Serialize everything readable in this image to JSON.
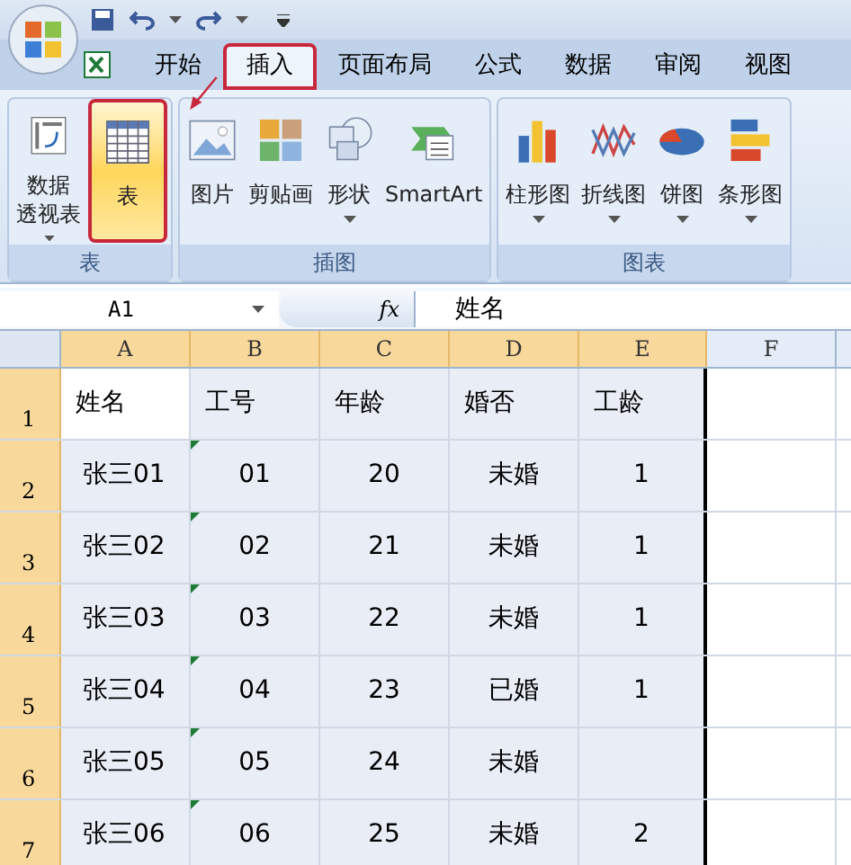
{
  "tabs": [
    {
      "label": "开始",
      "selected": false,
      "marked": false
    },
    {
      "label": "插入",
      "selected": true,
      "marked": true
    },
    {
      "label": "页面布局",
      "selected": false,
      "marked": false
    },
    {
      "label": "公式",
      "selected": false,
      "marked": false
    },
    {
      "label": "数据",
      "selected": false,
      "marked": false
    },
    {
      "label": "审阅",
      "selected": false,
      "marked": false
    },
    {
      "label": "视图",
      "selected": false,
      "marked": false
    }
  ],
  "ribbon": [
    {
      "title": "表",
      "buttons": [
        {
          "kind": "pivot",
          "label": "数据透视表",
          "dropdown": true,
          "highlighted": false
        },
        {
          "kind": "table",
          "label": "表",
          "dropdown": false,
          "highlighted": true
        }
      ]
    },
    {
      "title": "插图",
      "buttons": [
        {
          "kind": "picture",
          "label": "图片",
          "dropdown": false,
          "highlighted": false
        },
        {
          "kind": "clipart",
          "label": "剪贴画",
          "dropdown": false,
          "highlighted": false
        },
        {
          "kind": "shapes",
          "label": "形状",
          "dropdown": true,
          "highlighted": false
        },
        {
          "kind": "smartart",
          "label": "SmartArt",
          "dropdown": false,
          "highlighted": false
        }
      ]
    },
    {
      "title": "图表",
      "buttons": [
        {
          "kind": "column",
          "label": "柱形图",
          "dropdown": true,
          "highlighted": false
        },
        {
          "kind": "line",
          "label": "折线图",
          "dropdown": true,
          "highlighted": false
        },
        {
          "kind": "pie",
          "label": "饼图",
          "dropdown": true,
          "highlighted": false
        },
        {
          "kind": "bar",
          "label": "条形图",
          "dropdown": true,
          "highlighted": false
        }
      ]
    }
  ],
  "name_box": "A1",
  "fx": "fx",
  "formula": "姓名",
  "columns": [
    {
      "label": "A",
      "selected": true
    },
    {
      "label": "B",
      "selected": true
    },
    {
      "label": "C",
      "selected": true
    },
    {
      "label": "D",
      "selected": true
    },
    {
      "label": "E",
      "selected": true
    },
    {
      "label": "F",
      "selected": false
    }
  ],
  "rows": [
    {
      "header": "1",
      "selected": true,
      "cells": [
        {
          "text": "姓名",
          "active": true,
          "flag": false
        },
        {
          "text": "工号",
          "active": false,
          "flag": false
        },
        {
          "text": "年龄",
          "active": false,
          "flag": false
        },
        {
          "text": "婚否",
          "active": false,
          "flag": false
        },
        {
          "text": "工龄",
          "active": false,
          "flag": false
        }
      ]
    },
    {
      "header": "2",
      "selected": true,
      "cells": [
        {
          "text": "张三01",
          "active": false,
          "flag": false
        },
        {
          "text": "01",
          "active": false,
          "flag": true
        },
        {
          "text": "20",
          "active": false,
          "flag": false
        },
        {
          "text": "未婚",
          "active": false,
          "flag": false
        },
        {
          "text": "1",
          "active": false,
          "flag": false
        }
      ]
    },
    {
      "header": "3",
      "selected": true,
      "cells": [
        {
          "text": "张三02",
          "active": false,
          "flag": false
        },
        {
          "text": "02",
          "active": false,
          "flag": true
        },
        {
          "text": "21",
          "active": false,
          "flag": false
        },
        {
          "text": "未婚",
          "active": false,
          "flag": false
        },
        {
          "text": "1",
          "active": false,
          "flag": false
        }
      ]
    },
    {
      "header": "4",
      "selected": true,
      "cells": [
        {
          "text": "张三03",
          "active": false,
          "flag": false
        },
        {
          "text": "03",
          "active": false,
          "flag": true
        },
        {
          "text": "22",
          "active": false,
          "flag": false
        },
        {
          "text": "未婚",
          "active": false,
          "flag": false
        },
        {
          "text": "1",
          "active": false,
          "flag": false
        }
      ]
    },
    {
      "header": "5",
      "selected": true,
      "cells": [
        {
          "text": "张三04",
          "active": false,
          "flag": false
        },
        {
          "text": "04",
          "active": false,
          "flag": true
        },
        {
          "text": "23",
          "active": false,
          "flag": false
        },
        {
          "text": "已婚",
          "active": false,
          "flag": false
        },
        {
          "text": "1",
          "active": false,
          "flag": false
        }
      ]
    },
    {
      "header": "6",
      "selected": true,
      "cells": [
        {
          "text": "张三05",
          "active": false,
          "flag": false
        },
        {
          "text": "05",
          "active": false,
          "flag": true
        },
        {
          "text": "24",
          "active": false,
          "flag": false
        },
        {
          "text": "未婚",
          "active": false,
          "flag": false
        },
        {
          "active": false,
          "flag": false
        }
      ]
    },
    {
      "header": "7",
      "selected": true,
      "cells": [
        {
          "text": "张三06",
          "active": false,
          "flag": false
        },
        {
          "text": "06",
          "active": false,
          "flag": true
        },
        {
          "text": "25",
          "active": false,
          "flag": false
        },
        {
          "text": "未婚",
          "active": false,
          "flag": false
        },
        {
          "text": "2",
          "active": false,
          "flag": false
        }
      ]
    }
  ]
}
